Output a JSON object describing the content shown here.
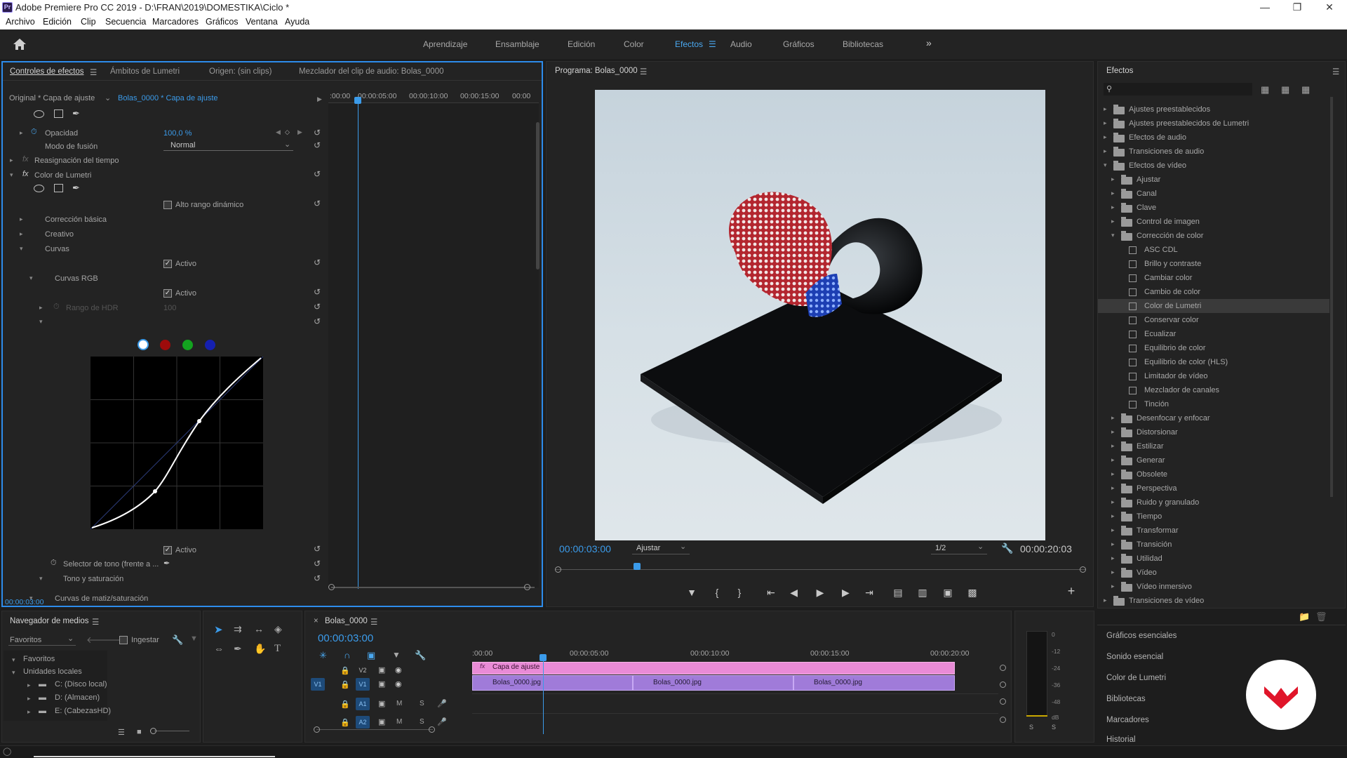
{
  "app": {
    "window_title": "Adobe Premiere Pro CC 2019 - D:\\FRAN\\2019\\DOMESTIKA\\Ciclo *",
    "icon_label": "Pr"
  },
  "menu": [
    "Archivo",
    "Edición",
    "Clip",
    "Secuencia",
    "Marcadores",
    "Gráficos",
    "Ventana",
    "Ayuda"
  ],
  "workspaces": [
    "Aprendizaje",
    "Ensamblaje",
    "Edición",
    "Color",
    "Efectos",
    "Audio",
    "Gráficos",
    "Bibliotecas"
  ],
  "workspace_active": "Efectos",
  "effect_controls": {
    "tabs": [
      "Controles de efectos",
      "Ámbitos de Lumetri",
      "Origen: (sin clips)",
      "Mezclador del clip de audio: Bolas_0000"
    ],
    "master": "Original * Capa de ajuste",
    "clip": "Bolas_0000 * Capa de ajuste",
    "ruler": [
      ":00:00",
      "00:00:05:00",
      "00:00:10:00",
      "00:00:15:00",
      "00:00"
    ],
    "rows": {
      "opacity_label": "Opacidad",
      "opacity_value": "100,0 %",
      "blend_label": "Modo de fusión",
      "blend_value": "Normal",
      "time_remap": "Reasignación del tiempo",
      "lumetri": "Color de Lumetri",
      "hdr": "Alto rango dinámico",
      "basic": "Corrección básica",
      "creative": "Creativo",
      "curves": "Curvas",
      "active1": "Activo",
      "rgb_curves": "Curvas RGB",
      "active2": "Activo",
      "hdr_range": "Rango de HDR",
      "hdr_range_value": "100",
      "hue_sat": "Curvas de matiz/saturación",
      "active3": "Activo",
      "hue_selector": "Selector de tono (frente a ...",
      "hue_vs_sat": "Tono y saturación"
    },
    "timecode": "00:00:03:00"
  },
  "program": {
    "title": "Programa: Bolas_0000",
    "timecode": "00:00:03:00",
    "fit": "Ajustar",
    "resolution": "1/2",
    "duration": "00:00:20:03",
    "playhead_fraction": 0.15
  },
  "effects_panel": {
    "title": "Efectos",
    "items": [
      {
        "label": "Ajustes preestablecidos",
        "level": 0,
        "type": "folder",
        "open": false
      },
      {
        "label": "Ajustes preestablecidos de Lumetri",
        "level": 0,
        "type": "folder",
        "open": false
      },
      {
        "label": "Efectos de audio",
        "level": 0,
        "type": "folder",
        "open": false
      },
      {
        "label": "Transiciones de audio",
        "level": 0,
        "type": "folder",
        "open": false
      },
      {
        "label": "Efectos de vídeo",
        "level": 0,
        "type": "folder",
        "open": true
      },
      {
        "label": "Ajustar",
        "level": 1,
        "type": "folder",
        "open": false
      },
      {
        "label": "Canal",
        "level": 1,
        "type": "folder",
        "open": false
      },
      {
        "label": "Clave",
        "level": 1,
        "type": "folder",
        "open": false
      },
      {
        "label": "Control de imagen",
        "level": 1,
        "type": "folder",
        "open": false
      },
      {
        "label": "Corrección de color",
        "level": 1,
        "type": "folder",
        "open": true
      },
      {
        "label": "ASC CDL",
        "level": 2,
        "type": "fx"
      },
      {
        "label": "Brillo y contraste",
        "level": 2,
        "type": "fx"
      },
      {
        "label": "Cambiar color",
        "level": 2,
        "type": "fx"
      },
      {
        "label": "Cambio de color",
        "level": 2,
        "type": "fx"
      },
      {
        "label": "Color de Lumetri",
        "level": 2,
        "type": "fx",
        "selected": true
      },
      {
        "label": "Conservar color",
        "level": 2,
        "type": "fx"
      },
      {
        "label": "Ecualizar",
        "level": 2,
        "type": "fx"
      },
      {
        "label": "Equilibrio de color",
        "level": 2,
        "type": "fx"
      },
      {
        "label": "Equilibrio de color (HLS)",
        "level": 2,
        "type": "fx"
      },
      {
        "label": "Limitador de vídeo",
        "level": 2,
        "type": "fx"
      },
      {
        "label": "Mezclador de canales",
        "level": 2,
        "type": "fx"
      },
      {
        "label": "Tinción",
        "level": 2,
        "type": "fx"
      },
      {
        "label": "Desenfocar y enfocar",
        "level": 1,
        "type": "folder",
        "open": false
      },
      {
        "label": "Distorsionar",
        "level": 1,
        "type": "folder",
        "open": false
      },
      {
        "label": "Estilizar",
        "level": 1,
        "type": "folder",
        "open": false
      },
      {
        "label": "Generar",
        "level": 1,
        "type": "folder",
        "open": false
      },
      {
        "label": "Obsolete",
        "level": 1,
        "type": "folder",
        "open": false
      },
      {
        "label": "Perspectiva",
        "level": 1,
        "type": "folder",
        "open": false
      },
      {
        "label": "Ruido y granulado",
        "level": 1,
        "type": "folder",
        "open": false
      },
      {
        "label": "Tiempo",
        "level": 1,
        "type": "folder",
        "open": false
      },
      {
        "label": "Transformar",
        "level": 1,
        "type": "folder",
        "open": false
      },
      {
        "label": "Transición",
        "level": 1,
        "type": "folder",
        "open": false
      },
      {
        "label": "Utilidad",
        "level": 1,
        "type": "folder",
        "open": false
      },
      {
        "label": "Vídeo",
        "level": 1,
        "type": "folder",
        "open": false
      },
      {
        "label": "Vídeo inmersivo",
        "level": 1,
        "type": "folder",
        "open": false
      },
      {
        "label": "Transiciones de vídeo",
        "level": 0,
        "type": "folder",
        "open": false
      }
    ],
    "side_panels": [
      "Gráficos esenciales",
      "Sonido esencial",
      "Color de Lumetri",
      "Bibliotecas",
      "Marcadores",
      "Historial"
    ]
  },
  "media_browser": {
    "title": "Navegador de medios",
    "dropdown": "Favoritos",
    "ingest": "Ingestar",
    "tree": [
      "Favoritos",
      "Unidades locales",
      "C: (Disco local)",
      "D: (Almacen)",
      "E: (CabezasHD)"
    ]
  },
  "timeline": {
    "title": "Bolas_0000",
    "timecode": "00:00:03:00",
    "ruler": [
      ":00:00",
      "00:00:05:00",
      "00:00:10:00",
      "00:00:15:00",
      "00:00:20:00"
    ],
    "tracks": [
      "V2",
      "V1",
      "A1",
      "A2"
    ],
    "source_patch": "V1",
    "adjustment_clip": "Capa de ajuste",
    "clips": [
      "Bolas_0000.jpg",
      "Bolas_0000.jpg",
      "Bolas_0000.jpg"
    ],
    "mute": "M",
    "solo": "S"
  },
  "meter": {
    "scale": [
      "0",
      "-12",
      "-24",
      "-36",
      "-48",
      "dB"
    ],
    "solo_buttons": [
      "S",
      "S"
    ]
  },
  "colors": {
    "accent": "#2d8ceb",
    "adjustment_clip": "#e98bd6",
    "video_clip": "#a07bd9",
    "brand": "#e0152a"
  }
}
